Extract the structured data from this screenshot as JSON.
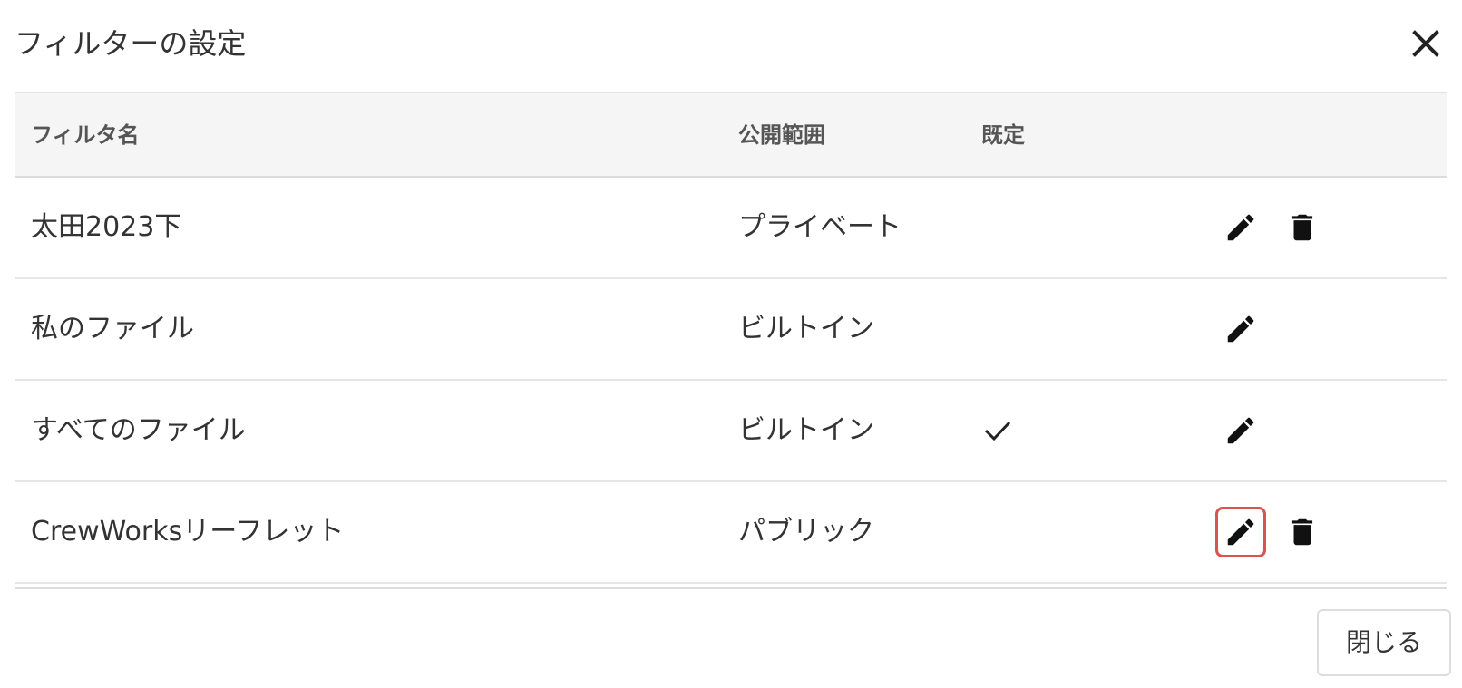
{
  "dialog": {
    "title": "フィルターの設定",
    "close_icon": "close-icon"
  },
  "table": {
    "headers": {
      "name": "フィルタ名",
      "scope": "公開範囲",
      "default": "既定"
    },
    "rows": [
      {
        "name": "太田2023下",
        "scope": "プライベート",
        "is_default": false,
        "editable": true,
        "deletable": true,
        "highlighted": false
      },
      {
        "name": "私のファイル",
        "scope": "ビルトイン",
        "is_default": false,
        "editable": true,
        "deletable": false,
        "highlighted": false
      },
      {
        "name": "すべてのファイル",
        "scope": "ビルトイン",
        "is_default": true,
        "editable": true,
        "deletable": false,
        "highlighted": false
      },
      {
        "name": "CrewWorksリーフレット",
        "scope": "パブリック",
        "is_default": false,
        "editable": true,
        "deletable": true,
        "highlighted": true
      }
    ],
    "icons": {
      "edit": "pencil-icon",
      "delete": "trash-icon",
      "default": "checkmark-icon"
    }
  },
  "footer": {
    "close_label": "閉じる"
  },
  "colors": {
    "highlight": "#d9534f",
    "header_bg": "#f5f5f5"
  }
}
